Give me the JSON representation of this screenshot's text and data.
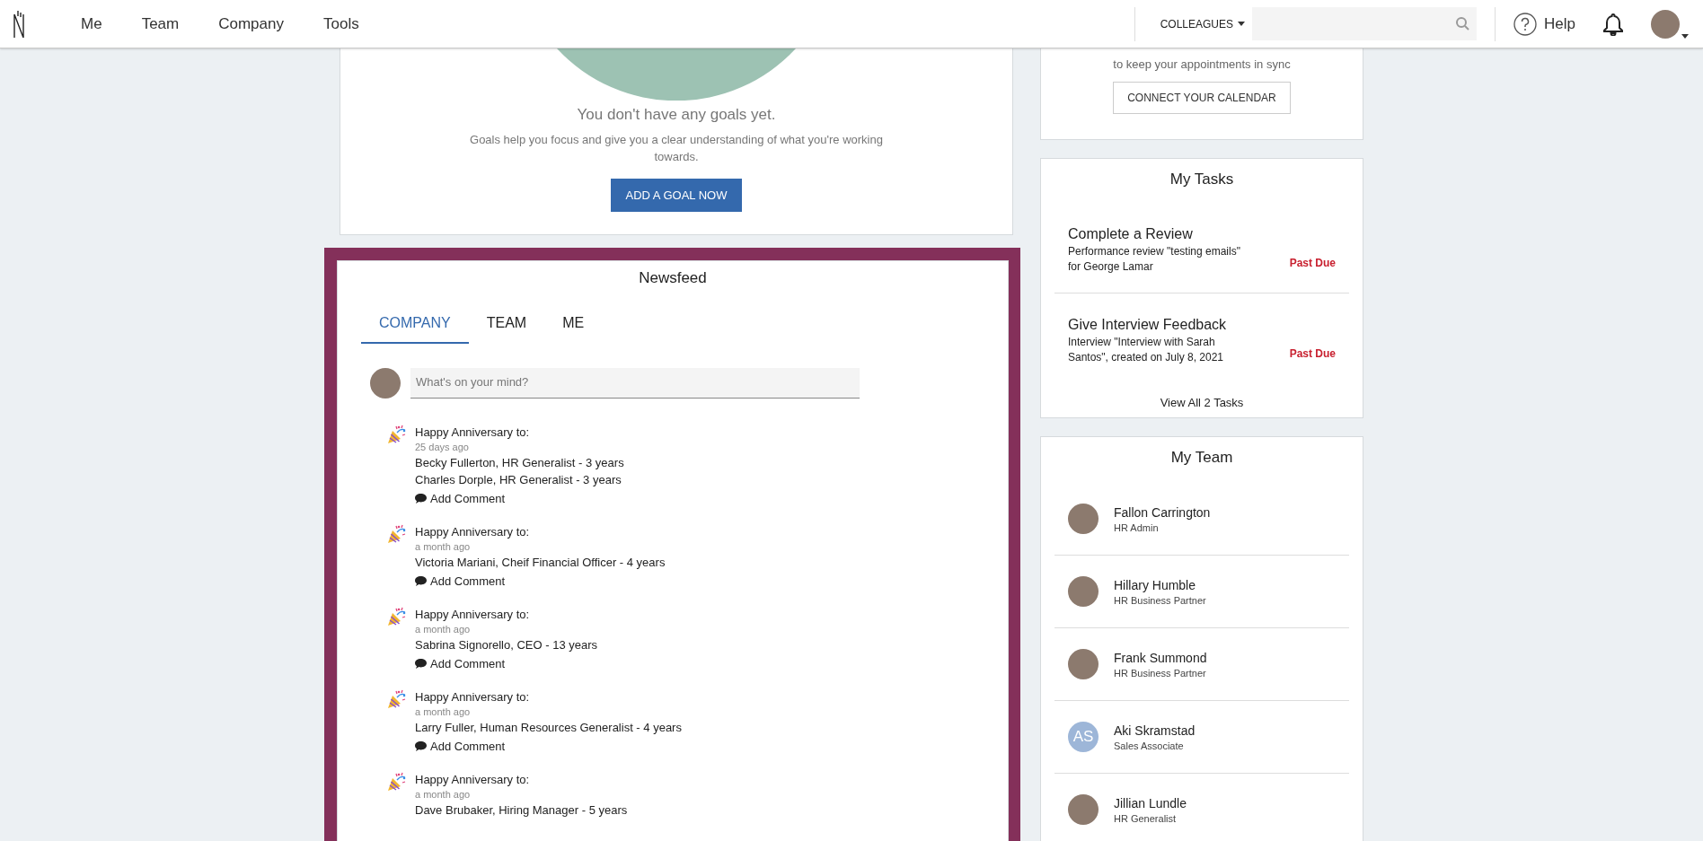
{
  "nav": {
    "items": [
      {
        "label": "Me"
      },
      {
        "label": "Team"
      },
      {
        "label": "Company"
      },
      {
        "label": "Tools"
      }
    ],
    "search_scope": "COLLEAGUES",
    "help": "Help"
  },
  "goals": {
    "heading": "You don't have any goals yet.",
    "text": "Goals help you focus and give you a clear understanding of what you're working towards.",
    "button": "ADD A GOAL NOW"
  },
  "newsfeed": {
    "title": "Newsfeed",
    "tabs": [
      {
        "label": "COMPANY",
        "selected": true
      },
      {
        "label": "TEAM",
        "selected": false
      },
      {
        "label": "ME",
        "selected": false
      }
    ],
    "composer": {
      "placeholder": "What's on your mind?"
    },
    "posts": [
      {
        "heading": "Happy Anniversary to:",
        "time": "25 days ago",
        "lines": [
          "Becky Fullerton, HR Generalist - 3 years",
          "Charles Dorple, HR Generalist - 3 years"
        ],
        "action": "Add Comment"
      },
      {
        "heading": "Happy Anniversary to:",
        "time": "a month ago",
        "lines": [
          "Victoria Mariani, Cheif Financial Officer - 4 years"
        ],
        "action": "Add Comment"
      },
      {
        "heading": "Happy Anniversary to:",
        "time": "a month ago",
        "lines": [
          "Sabrina Signorello, CEO - 13 years"
        ],
        "action": "Add Comment"
      },
      {
        "heading": "Happy Anniversary to:",
        "time": "a month ago",
        "lines": [
          "Larry Fuller, Human Resources Generalist - 4 years"
        ],
        "action": "Add Comment"
      },
      {
        "heading": "Happy Anniversary to:",
        "time": "a month ago",
        "lines": [
          "Dave Brubaker, Hiring Manager - 5 years"
        ]
      }
    ]
  },
  "calendar": {
    "text": "to keep your appointments in sync",
    "button": "CONNECT YOUR CALENDAR"
  },
  "tasks": {
    "title": "My Tasks",
    "items": [
      {
        "title": "Complete a Review",
        "detail": "Performance review \"testing emails\" for George Lamar",
        "status": "Past Due"
      },
      {
        "title": "Give Interview Feedback",
        "detail": "Interview \"Interview with Sarah Santos\", created on July 8, 2021",
        "status": "Past Due"
      }
    ],
    "link": "View All 2 Tasks"
  },
  "team": {
    "title": "My Team",
    "members": [
      {
        "kind": "photo",
        "name": "Fallon Carrington",
        "role": "HR Admin"
      },
      {
        "kind": "photo",
        "name": "Hillary Humble",
        "role": "HR Business Partner"
      },
      {
        "kind": "photo",
        "name": "Frank Summond",
        "role": "HR Business Partner"
      },
      {
        "kind": "initials",
        "initials": "AS",
        "name": "Aki Skramstad",
        "role": "Sales Associate"
      },
      {
        "kind": "photo",
        "name": "Jillian Lundle",
        "role": "HR Generalist"
      }
    ]
  }
}
